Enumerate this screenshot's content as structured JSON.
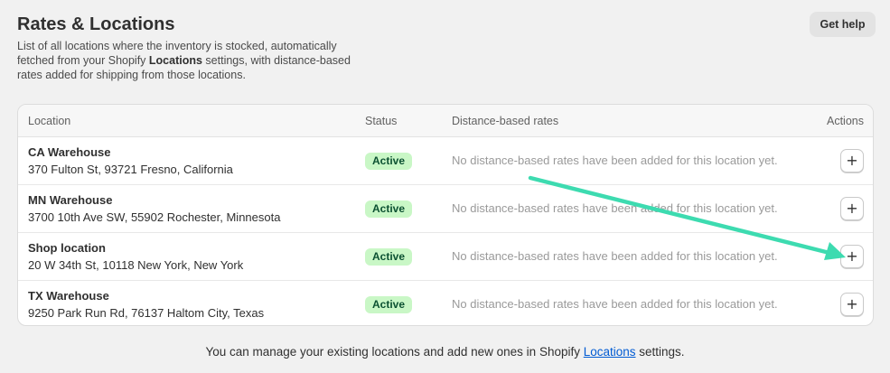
{
  "header": {
    "title": "Rates & Locations",
    "description_before": "List of all locations where the inventory is stocked, automatically fetched from your Shopify ",
    "description_bold": "Locations",
    "description_after": " settings, with distance-based rates added for shipping from those locations.",
    "help_label": "Get help"
  },
  "table": {
    "columns": {
      "location": "Location",
      "status": "Status",
      "rates": "Distance-based rates",
      "actions": "Actions"
    },
    "rows": [
      {
        "name": "CA Warehouse",
        "address": "370 Fulton St, 93721 Fresno, California",
        "status": "Active",
        "rates": "No distance-based rates have been added for this location yet.",
        "action_icon": "plus-icon",
        "action_glyph": "+"
      },
      {
        "name": "MN Warehouse",
        "address": "3700 10th Ave SW, 55902 Rochester, Minnesota",
        "status": "Active",
        "rates": "No distance-based rates have been added for this location yet.",
        "action_icon": "plus-icon",
        "action_glyph": "+"
      },
      {
        "name": "Shop location",
        "address": "20 W 34th St, 10118 New York, New York",
        "status": "Active",
        "rates": "No distance-based rates have been added for this location yet.",
        "action_icon": "plus-icon",
        "action_glyph": "+"
      },
      {
        "name": "TX Warehouse",
        "address": "9250 Park Run Rd, 76137 Haltom City, Texas",
        "status": "Active",
        "rates": "No distance-based rates have been added for this location yet.",
        "action_icon": "plus-icon",
        "action_glyph": "+"
      }
    ]
  },
  "footer": {
    "text_before": "You can manage your existing locations and add new ones in Shopify ",
    "link": "Locations",
    "text_after": " settings."
  },
  "colors": {
    "background": "#f1f1f1",
    "status_badge_bg": "#c9f7c6",
    "status_badge_text": "#0c5132",
    "annotation_arrow": "#3ddbb0",
    "link": "#005bd3"
  }
}
